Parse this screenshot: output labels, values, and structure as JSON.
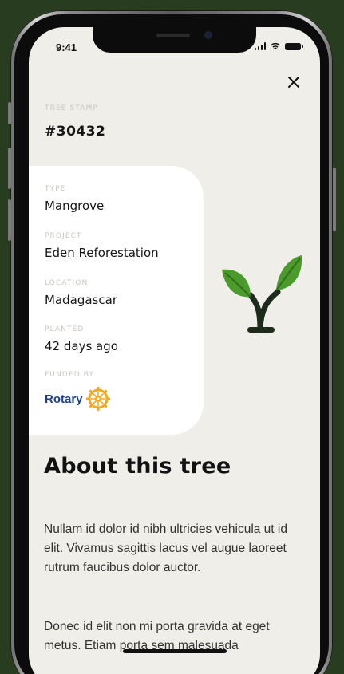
{
  "status_bar": {
    "time": "9:41"
  },
  "tree_stamp": {
    "label": "TREE STAMP",
    "value": "#30432"
  },
  "details": {
    "type_label": "TYPE",
    "type_value": "Mangrove",
    "project_label": "PROJECT",
    "project_value": "Eden Reforestation",
    "location_label": "LOCATION",
    "location_value": "Madagascar",
    "planted_label": "PLANTED",
    "planted_value": "42 days ago",
    "funded_label": "FUNDED BY",
    "funder_name": "Rotary"
  },
  "about": {
    "title": "About this tree",
    "paragraph_1": "Nullam id dolor id nibh ultricies vehicula ut id elit. Vivamus sagittis lacus vel augue laoreet rutrum faucibus dolor auctor.",
    "paragraph_2": "Donec id elit non mi porta gravida at eget metus. Etiam porta sem malesuada"
  },
  "icons": {
    "close": "close-icon",
    "sprout": "sprout-icon",
    "rotary_logo": "rotary-wheel-icon"
  },
  "colors": {
    "background": "#283d20",
    "screen": "#efeee9",
    "card": "#ffffff",
    "leaf_green": "#4a9a2c",
    "trunk": "#1c2b1a",
    "rotary_blue": "#1b3f8f",
    "rotary_gold": "#f7a81b"
  }
}
